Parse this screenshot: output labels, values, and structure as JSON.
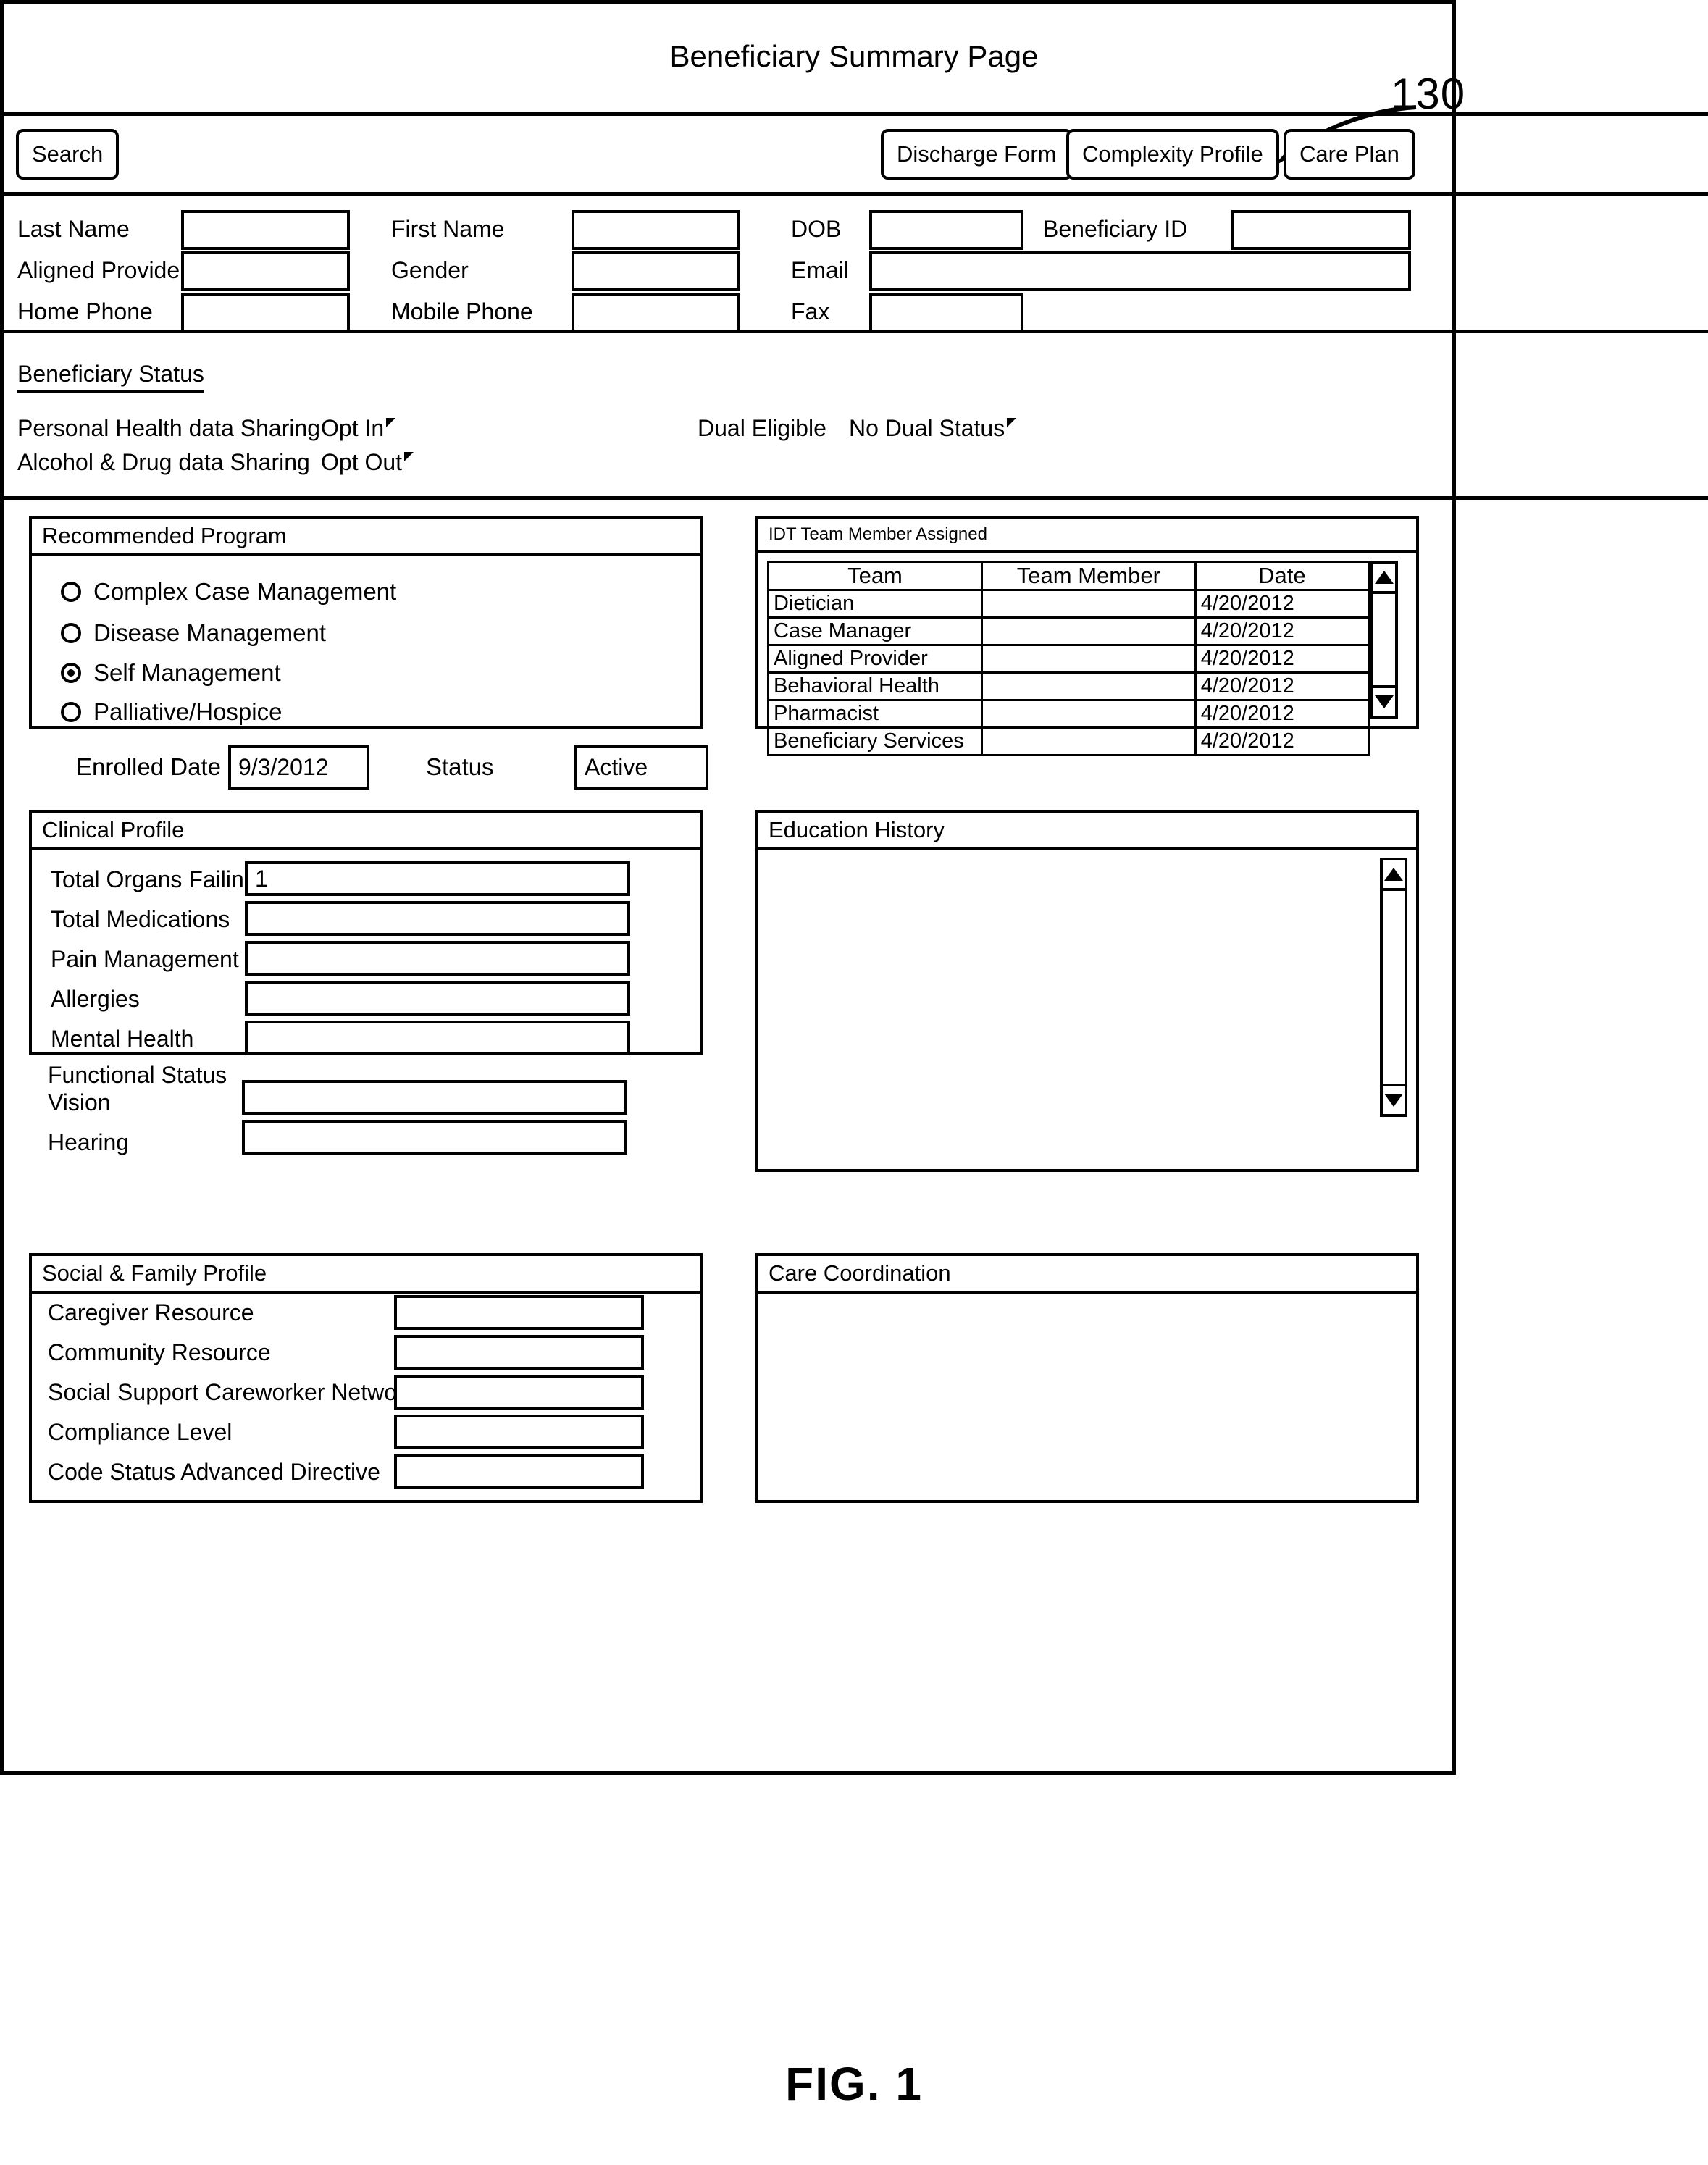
{
  "figure": {
    "reference_numeral": "130",
    "caption": "FIG. 1"
  },
  "window": {
    "title": "Beneficiary Summary Page"
  },
  "toolbar": {
    "search_label": "Search",
    "discharge_form_label": "Discharge Form",
    "complexity_profile_label": "Complexity Profile",
    "care_plan_label": "Care Plan"
  },
  "demographics": {
    "fields": [
      {
        "label": "Last Name",
        "value": ""
      },
      {
        "label": "First Name",
        "value": ""
      },
      {
        "label": "DOB",
        "value": ""
      },
      {
        "label": "Beneficiary ID",
        "value": ""
      },
      {
        "label": "Aligned Provider",
        "value": ""
      },
      {
        "label": "Gender",
        "value": ""
      },
      {
        "label": "Email",
        "value": ""
      },
      {
        "label": "Home Phone",
        "value": ""
      },
      {
        "label": "Mobile Phone",
        "value": ""
      },
      {
        "label": "Fax",
        "value": ""
      }
    ]
  },
  "beneficiary_status": {
    "heading": "Beneficiary Status",
    "personal_health_label": "Personal Health data Sharing",
    "personal_health_value": "Opt In",
    "alcohol_drug_label": "Alcohol & Drug data Sharing",
    "alcohol_drug_value": "Opt Out",
    "dual_eligible_label": "Dual Eligible",
    "dual_eligible_value": "No Dual Status"
  },
  "recommended_program": {
    "title": "Recommended Program",
    "options": [
      {
        "label": "Complex Case Management",
        "selected": false
      },
      {
        "label": "Disease Management",
        "selected": false
      },
      {
        "label": "Self Management",
        "selected": true
      },
      {
        "label": "Palliative/Hospice",
        "selected": false
      }
    ],
    "enrolled_date_label": "Enrolled Date",
    "enrolled_date_value": "9/3/2012",
    "status_label": "Status",
    "status_value": "Active"
  },
  "idt_team": {
    "title": "IDT Team Member Assigned",
    "columns": [
      "Team",
      "Team Member",
      "Date"
    ],
    "rows": [
      {
        "team": "Dietician",
        "member": "",
        "date": "4/20/2012"
      },
      {
        "team": "Case Manager",
        "member": "",
        "date": "4/20/2012"
      },
      {
        "team": "Aligned Provider",
        "member": "",
        "date": "4/20/2012"
      },
      {
        "team": "Behavioral Health",
        "member": "",
        "date": "4/20/2012"
      },
      {
        "team": "Pharmacist",
        "member": "",
        "date": "4/20/2012"
      },
      {
        "team": "Beneficiary Services",
        "member": "",
        "date": "4/20/2012"
      }
    ]
  },
  "clinical_profile": {
    "title": "Clinical Profile",
    "rows": [
      {
        "label": "Total Organs Failing",
        "value": "1",
        "has_input": true
      },
      {
        "label": "Total Medications",
        "value": "",
        "has_input": true
      },
      {
        "label": "Pain Management",
        "value": "",
        "has_input": true
      },
      {
        "label": "Allergies",
        "value": "",
        "has_input": true
      },
      {
        "label": "Mental Health",
        "value": "",
        "has_input": true
      },
      {
        "label": "Functional Status",
        "value": "",
        "has_input": false
      },
      {
        "label": "Vision",
        "value": "",
        "has_input": true
      },
      {
        "label": "Hearing",
        "value": "",
        "has_input": true
      }
    ]
  },
  "education_history": {
    "title": "Education History",
    "content": ""
  },
  "social_family_profile": {
    "title": "Social & Family Profile",
    "rows": [
      {
        "label": "Caregiver Resource",
        "value": ""
      },
      {
        "label": "Community Resource",
        "value": ""
      },
      {
        "label": "Social Support Careworker Network",
        "value": ""
      },
      {
        "label": "Compliance Level",
        "value": ""
      },
      {
        "label": "Code Status Advanced Directive",
        "value": ""
      }
    ]
  },
  "care_coordination": {
    "title": "Care Coordination",
    "content": ""
  }
}
